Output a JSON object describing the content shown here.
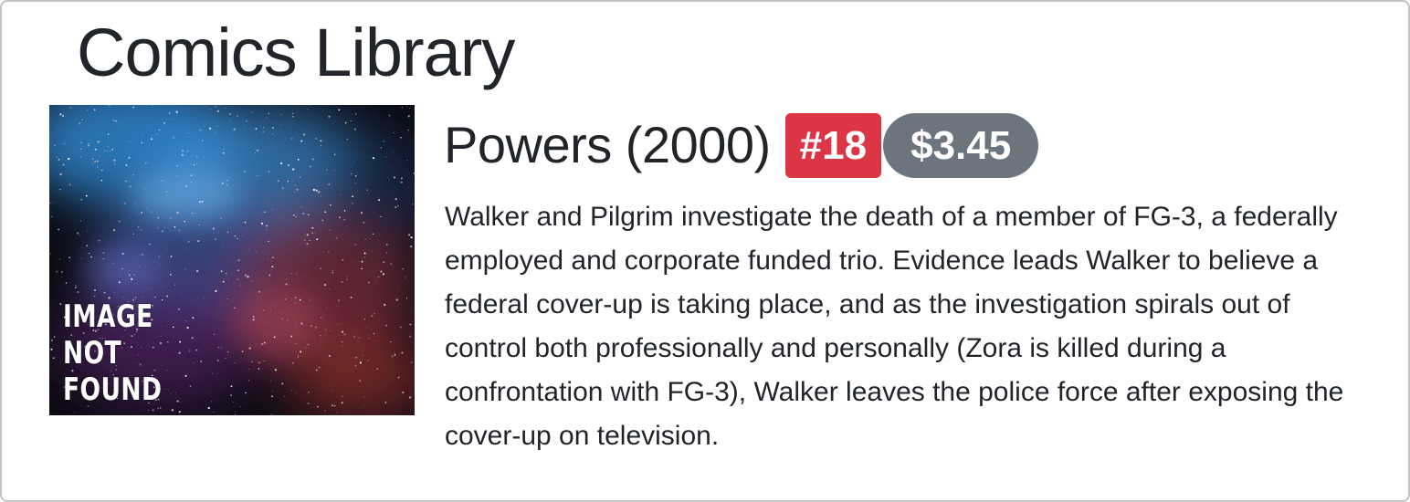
{
  "page": {
    "title": "Comics Library"
  },
  "comic": {
    "title": "Powers (2000)",
    "issue_badge": "#18",
    "price_badge": "$3.45",
    "cover": {
      "lines": [
        "IMAGE",
        "NOT",
        "FOUND"
      ]
    },
    "description": "Walker and Pilgrim investigate the death of a member of FG-3, a federally employed and corporate funded trio. Evidence leads Walker to believe a federal cover-up is taking place, and as the investigation spirals out of control both professionally and personally (Zora is killed during a confrontation with FG-3), Walker leaves the police force after exposing the cover-up on television."
  },
  "colors": {
    "issue_badge_bg": "#dc3545",
    "price_badge_bg": "#6c757d",
    "text": "#212529"
  }
}
